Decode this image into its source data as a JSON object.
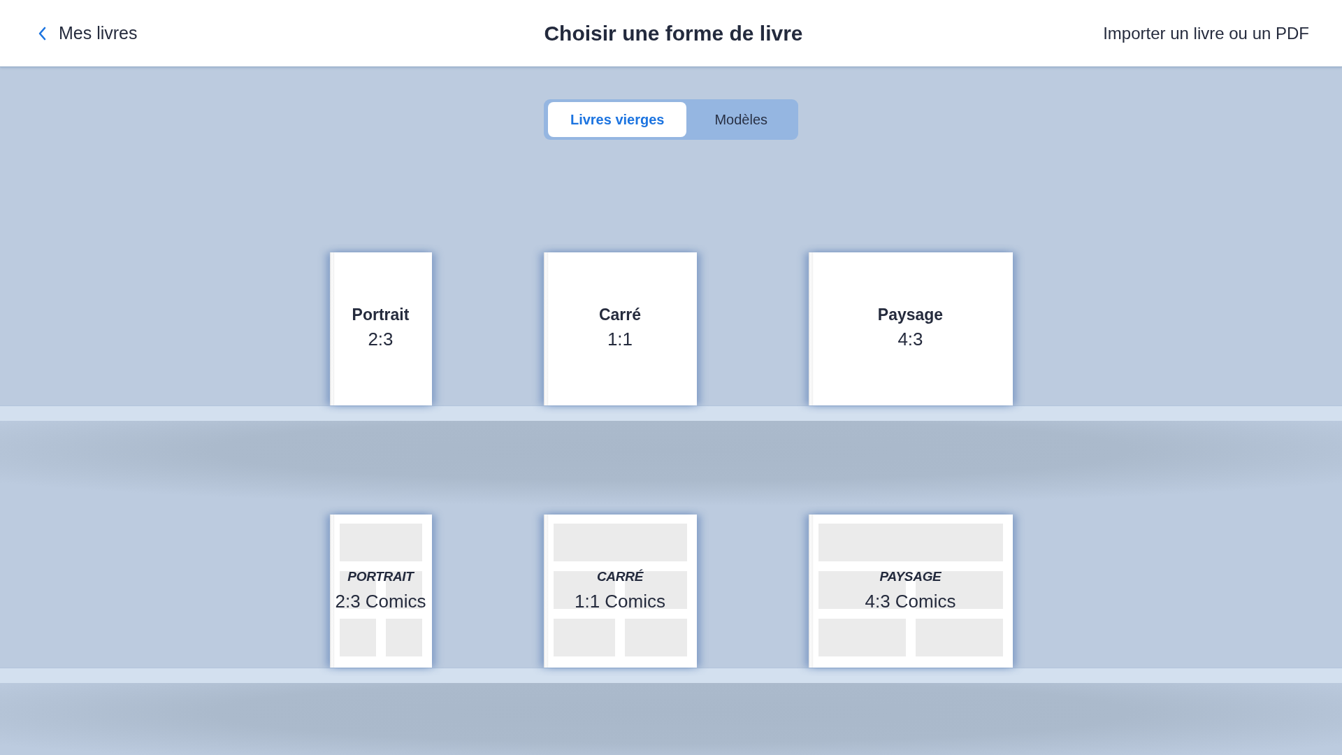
{
  "header": {
    "back_link": "Mes livres",
    "title": "Choisir une forme de livre",
    "import_link": "Importer un livre ou un PDF"
  },
  "tabs": [
    {
      "label": "Livres vierges",
      "selected": true
    },
    {
      "label": "Modèles",
      "selected": false
    }
  ],
  "shelves": [
    {
      "books": [
        {
          "kind": "blank",
          "title": "Portrait",
          "ratio": "2:3"
        },
        {
          "kind": "blank",
          "title": "Carré",
          "ratio": "1:1"
        },
        {
          "kind": "blank",
          "title": "Paysage",
          "ratio": "4:3"
        }
      ]
    },
    {
      "books": [
        {
          "kind": "comics",
          "title": "PORTRAIT",
          "ratio": "2:3 Comics"
        },
        {
          "kind": "comics",
          "title": "CARRÉ",
          "ratio": "1:1 Comics"
        },
        {
          "kind": "comics",
          "title": "PAYSAGE",
          "ratio": "4:3 Comics"
        }
      ]
    }
  ]
}
